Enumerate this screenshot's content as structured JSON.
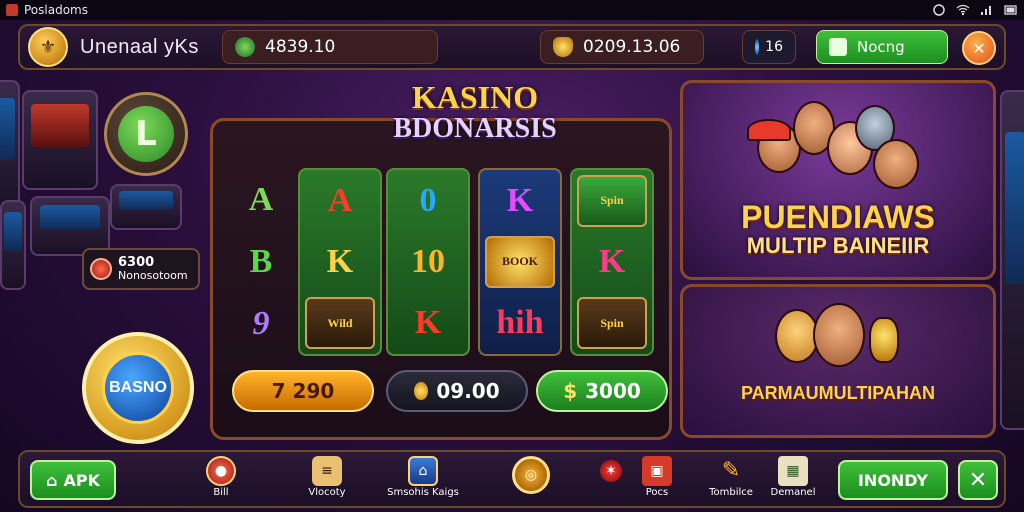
{
  "statusbar": {
    "app_name": "Posladoms"
  },
  "header": {
    "title": "Unenaal  yKs",
    "balance1": "4839.10",
    "balance2": "0209.13.06",
    "counter": "16",
    "action_label": "Nocng"
  },
  "left": {
    "badge_letter": "L",
    "info_value": "6300",
    "info_label": "Nonosotoom",
    "coin_label": "BASNO"
  },
  "slot": {
    "title_line1": "KASINO",
    "title_line2": "BDONARSIS",
    "left_symbols": [
      "A",
      "B",
      "9"
    ],
    "reels": [
      {
        "symbols": [
          "A",
          "K",
          "Wild"
        ]
      },
      {
        "symbols": [
          "0",
          "10",
          "K"
        ]
      },
      {
        "symbols": [
          "K",
          "BOOK",
          "hih"
        ]
      },
      {
        "symbols": [
          "Spin",
          "K",
          "Spin"
        ]
      }
    ],
    "bet_value": "7 290",
    "win_value": "09.00",
    "total_value": "3000"
  },
  "promo": {
    "panel1_line1": "PUENDIAWS",
    "panel1_line2": "MULTIP BAINEIIR",
    "panel2_text": "PARMAUMULTIPAHAN"
  },
  "bottomnav": {
    "apk_label": "APK",
    "items": [
      {
        "label": "Bill"
      },
      {
        "label": "Vlocoty"
      },
      {
        "label": "Smsohis Kaigs"
      },
      {
        "label": ""
      },
      {
        "label": "Pocs"
      },
      {
        "label": "Tombilce"
      },
      {
        "label": "Demanel"
      }
    ],
    "primary_label": "INONDY"
  },
  "colors": {
    "accent_gold": "#ffd24a",
    "accent_green": "#3fbf3a",
    "frame_brown": "#8a4a2a",
    "bg_purple": "#2a0f3d"
  },
  "icons": [
    "shield-icon",
    "wifi-icon",
    "gear-icon",
    "close-icon",
    "coin-icon",
    "gem-icon",
    "home-icon",
    "x-icon"
  ]
}
